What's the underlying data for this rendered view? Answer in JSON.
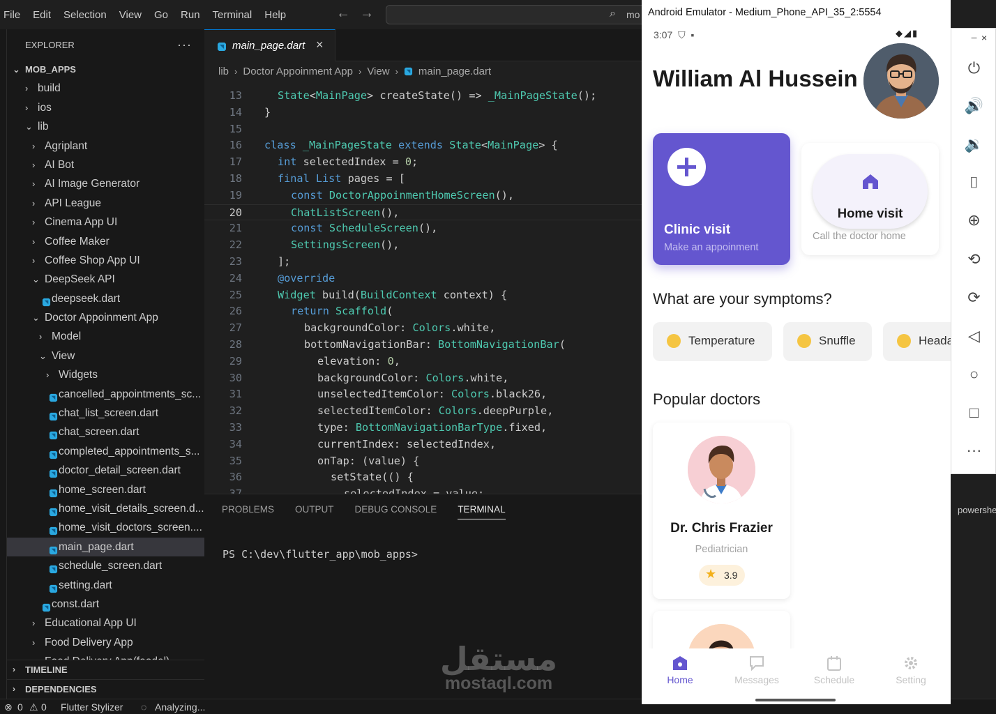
{
  "menubar": {
    "items": [
      "File",
      "Edit",
      "Selection",
      "View",
      "Go",
      "Run",
      "Terminal",
      "Help"
    ],
    "search_text": "mo"
  },
  "sidebar": {
    "title": "EXPLORER",
    "more": "···",
    "root": "MOB_APPS",
    "tree": [
      {
        "label": "build",
        "indent": 1,
        "kind": "folder",
        "open": false
      },
      {
        "label": "ios",
        "indent": 1,
        "kind": "folder",
        "open": false
      },
      {
        "label": "lib",
        "indent": 1,
        "kind": "folder",
        "open": true
      },
      {
        "label": "Agriplant",
        "indent": 2,
        "kind": "folder",
        "open": false
      },
      {
        "label": "AI Bot",
        "indent": 2,
        "kind": "folder",
        "open": false
      },
      {
        "label": "AI Image Generator",
        "indent": 2,
        "kind": "folder",
        "open": false
      },
      {
        "label": "API League",
        "indent": 2,
        "kind": "folder",
        "open": false
      },
      {
        "label": "Cinema App UI",
        "indent": 2,
        "kind": "folder",
        "open": false
      },
      {
        "label": "Coffee Maker",
        "indent": 2,
        "kind": "folder",
        "open": false
      },
      {
        "label": "Coffee Shop App UI",
        "indent": 2,
        "kind": "folder",
        "open": false
      },
      {
        "label": "DeepSeek API",
        "indent": 2,
        "kind": "folder",
        "open": true
      },
      {
        "label": "deepseek.dart",
        "indent": 3,
        "kind": "file"
      },
      {
        "label": "Doctor Appoinment App",
        "indent": 2,
        "kind": "folder",
        "open": true
      },
      {
        "label": "Model",
        "indent": 3,
        "kind": "folder",
        "open": false
      },
      {
        "label": "View",
        "indent": 3,
        "kind": "folder",
        "open": true
      },
      {
        "label": "Widgets",
        "indent": 4,
        "kind": "folder",
        "open": false
      },
      {
        "label": "cancelled_appointments_sc...",
        "indent": 4,
        "kind": "file"
      },
      {
        "label": "chat_list_screen.dart",
        "indent": 4,
        "kind": "file"
      },
      {
        "label": "chat_screen.dart",
        "indent": 4,
        "kind": "file"
      },
      {
        "label": "completed_appointments_s...",
        "indent": 4,
        "kind": "file"
      },
      {
        "label": "doctor_detail_screen.dart",
        "indent": 4,
        "kind": "file"
      },
      {
        "label": "home_screen.dart",
        "indent": 4,
        "kind": "file"
      },
      {
        "label": "home_visit_details_screen.d...",
        "indent": 4,
        "kind": "file"
      },
      {
        "label": "home_visit_doctors_screen....",
        "indent": 4,
        "kind": "file"
      },
      {
        "label": "main_page.dart",
        "indent": 4,
        "kind": "file",
        "selected": true
      },
      {
        "label": "schedule_screen.dart",
        "indent": 4,
        "kind": "file"
      },
      {
        "label": "setting.dart",
        "indent": 4,
        "kind": "file"
      },
      {
        "label": "const.dart",
        "indent": 3,
        "kind": "file"
      },
      {
        "label": "Educational App UI",
        "indent": 2,
        "kind": "folder",
        "open": false
      },
      {
        "label": "Food Delivery App",
        "indent": 2,
        "kind": "folder",
        "open": false
      },
      {
        "label": "Food Delivery App(foodel)",
        "indent": 2,
        "kind": "folder",
        "open": false
      }
    ],
    "timeline": "TIMELINE",
    "dependencies": "DEPENDENCIES"
  },
  "editor": {
    "tab_name": "main_page.dart",
    "breadcrumb": [
      "lib",
      "Doctor Appoinment App",
      "View",
      "main_page.dart"
    ],
    "current_line": "20",
    "lines": [
      {
        "n": "13",
        "t": "State<MainPage> createState() => _MainPageState();",
        "i": 1
      },
      {
        "n": "14",
        "t": "}",
        "i": 0
      },
      {
        "n": "15",
        "t": "",
        "i": 0
      },
      {
        "n": "16",
        "t": "class _MainPageState extends State<MainPage> {",
        "i": 0
      },
      {
        "n": "17",
        "t": "int selectedIndex = 0;",
        "i": 1
      },
      {
        "n": "18",
        "t": "final List pages = [",
        "i": 1
      },
      {
        "n": "19",
        "t": "const DoctorAppoinmentHomeScreen(),",
        "i": 2
      },
      {
        "n": "20",
        "t": "ChatListScreen(),",
        "i": 2
      },
      {
        "n": "21",
        "t": "const ScheduleScreen(),",
        "i": 2
      },
      {
        "n": "22",
        "t": "SettingsScreen(),",
        "i": 2
      },
      {
        "n": "23",
        "t": "];",
        "i": 1
      },
      {
        "n": "24",
        "t": "@override",
        "i": 1
      },
      {
        "n": "25",
        "t": "Widget build(BuildContext context) {",
        "i": 1
      },
      {
        "n": "26",
        "t": "return Scaffold(",
        "i": 2
      },
      {
        "n": "27",
        "t": "backgroundColor: Colors.white,",
        "i": 3
      },
      {
        "n": "28",
        "t": "bottomNavigationBar: BottomNavigationBar(",
        "i": 3
      },
      {
        "n": "29",
        "t": "elevation: 0,",
        "i": 4
      },
      {
        "n": "30",
        "t": "backgroundColor: Colors.white,",
        "i": 4
      },
      {
        "n": "31",
        "t": "unselectedItemColor: Colors.black26,",
        "i": 4
      },
      {
        "n": "32",
        "t": "selectedItemColor: Colors.deepPurple,",
        "i": 4
      },
      {
        "n": "33",
        "t": "type: BottomNavigationBarType.fixed,",
        "i": 4
      },
      {
        "n": "34",
        "t": "currentIndex: selectedIndex,",
        "i": 4
      },
      {
        "n": "35",
        "t": "onTap: (value) {",
        "i": 4
      },
      {
        "n": "36",
        "t": "setState(() {",
        "i": 5
      },
      {
        "n": "37",
        "t": "selectedIndex = value;",
        "i": 6
      }
    ]
  },
  "panel": {
    "tabs": [
      "PROBLEMS",
      "OUTPUT",
      "DEBUG CONSOLE",
      "TERMINAL"
    ],
    "active_tab": "TERMINAL",
    "prompt": "PS C:\\dev\\flutter_app\\mob_apps>"
  },
  "statusbar": {
    "errors": "0",
    "warnings": "0",
    "extension": "Flutter Stylizer",
    "analyzing": "Analyzing..."
  },
  "emulator": {
    "window_title": "Android Emulator - Medium_Phone_API_35_2:5554",
    "time": "3:07",
    "user_name": "William Al Hussein",
    "clinic": {
      "title": "Clinic visit",
      "subtitle": "Make an appoinment"
    },
    "home_visit": {
      "title": "Home visit",
      "subtitle": "Call the doctor home"
    },
    "symptoms_title": "What are your symptoms?",
    "symptoms": [
      "Temperature",
      "Snuffle",
      "Heada"
    ],
    "popular_title": "Popular doctors",
    "doctors": [
      {
        "name": "Dr. Chris Frazier",
        "specialty": "Pediatrician",
        "rating": "3.9"
      }
    ],
    "nav": [
      "Home",
      "Messages",
      "Schedule",
      "Setting"
    ],
    "accent": "#6456cf"
  },
  "right_panel": {
    "terminal_label": "powershe"
  },
  "watermark": {
    "arabic": "مستقل",
    "latin": "mostaql.com"
  }
}
